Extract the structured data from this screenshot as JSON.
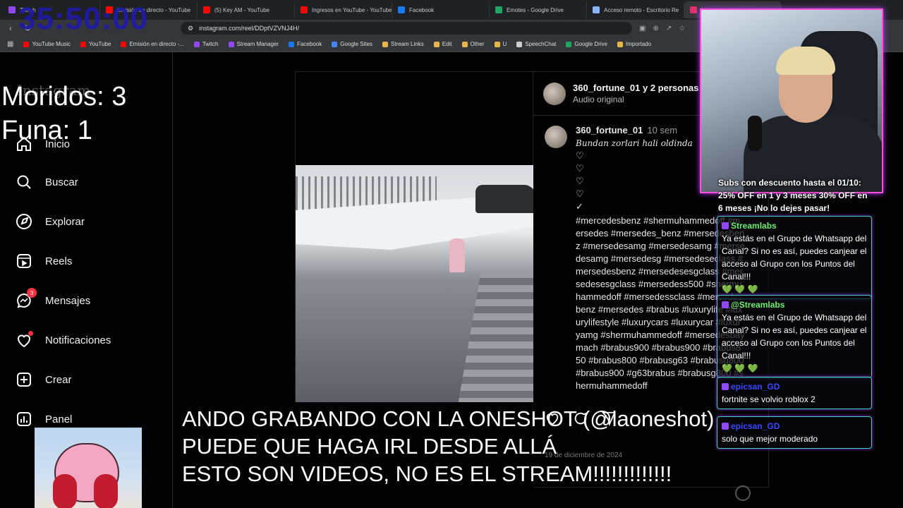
{
  "overlay": {
    "timer": "35:50:00",
    "deaths": "Moridos: 3",
    "funa": "Funa: 1",
    "promo": "Subs con descuento hasta el 01/10: 25% OFF en 1 y 3 meses 30% OFF en 6 meses ¡No lo dejes pasar!",
    "banner_lines": [
      "ANDO GRABANDO CON LA ONESHOT (@laoneshot)",
      "PUEDE QUE HAGA IRL DESDE ALLÁ",
      "ESTO SON VIDEOS, NO ES EL STREAM!!!!!!!!!!!!!"
    ],
    "chat": [
      {
        "user": "Streamlabs",
        "text": "Ya estás en el Grupo de Whatsapp del Canal? Si no es así, puedes canjear el acceso al Grupo con los Puntos del Canal!!!",
        "hearts": "💚 💚 💚"
      },
      {
        "user": "@Streamlabs",
        "text": "Ya estás en el Grupo de Whatsapp del Canal? Si no es así, puedes canjear el acceso al Grupo con los Puntos del Canal!!!",
        "hearts": "💚 💚 💚"
      },
      {
        "user": "epicsan_GD",
        "text": "fortnite se volvio roblox 2",
        "hearts": ""
      },
      {
        "user": "epicsan_GD",
        "text": "solo que mejor moderado",
        "hearts": ""
      }
    ]
  },
  "browser": {
    "tabs": [
      {
        "label": "Twitch",
        "color": "#9146ff"
      },
      {
        "label": "Emisión en directo - YouTube",
        "color": "#ff0000"
      },
      {
        "label": "(5) Key AM - YouTube",
        "color": "#ff0000"
      },
      {
        "label": "Ingresos en YouTube - YouTube",
        "color": "#ff0000"
      },
      {
        "label": "Facebook",
        "color": "#1877f2"
      },
      {
        "label": "Emotes - Google Drive",
        "color": "#1fa463"
      },
      {
        "label": "Acceso remoto - Escritorio Re",
        "color": "#8ab4f8"
      },
      {
        "label": "Instagram",
        "color": "#e1306c"
      }
    ],
    "url": "instagram.com/reel/DDptVZVNJ4H/",
    "bookmarks": [
      {
        "label": "YouTube Music",
        "color": "#ff0000"
      },
      {
        "label": "YouTube",
        "color": "#ff0000"
      },
      {
        "label": "Emisión en directo -...",
        "color": "#ff0000"
      },
      {
        "label": "Twitch",
        "color": "#9146ff"
      },
      {
        "label": "Stream Manager",
        "color": "#9146ff"
      },
      {
        "label": "Facebook",
        "color": "#1877f2"
      },
      {
        "label": "Google Sites",
        "color": "#4285f4"
      },
      {
        "label": "Stream Links",
        "color": "#e8b64a"
      },
      {
        "label": "Edit",
        "color": "#e8b64a"
      },
      {
        "label": "Other",
        "color": "#e8b64a"
      },
      {
        "label": "U",
        "color": "#e8b64a"
      },
      {
        "label": "SpeechChat",
        "color": "#cccccc"
      },
      {
        "label": "Google Drive",
        "color": "#1fa463"
      },
      {
        "label": "Importado",
        "color": "#e8b64a"
      }
    ]
  },
  "instagram": {
    "logo": "Instagram",
    "nav": [
      {
        "label": "Inicio",
        "icon": "home-icon"
      },
      {
        "label": "Buscar",
        "icon": "search-icon"
      },
      {
        "label": "Explorar",
        "icon": "compass-icon"
      },
      {
        "label": "Reels",
        "icon": "reels-icon"
      },
      {
        "label": "Mensajes",
        "icon": "messenger-icon",
        "badge": "3"
      },
      {
        "label": "Notificaciones",
        "icon": "heart-icon"
      },
      {
        "label": "Crear",
        "icon": "plus-square-icon"
      },
      {
        "label": "Panel",
        "icon": "chart-icon"
      }
    ],
    "post": {
      "header_user": "360_fortune_01 y 2 personas más",
      "header_sub": "Audio original",
      "caption_user": "360_fortune_01",
      "caption_time": "10 sem",
      "caption_first": "Bundan zorlari hali oldinda",
      "caption_lines": [
        "♡",
        "♡",
        "♡",
        "♡",
        "✓"
      ],
      "hashtags": "#mercedesbenz #shermuhammedoff #mersedes #mersedes_benz #mersedesbenz #mersedesamg #mersedesamg #mersedesamg #mersedesg #mersedeseclass #mersedesbenz #mersedesesgclass #mersedesesgclass #mersedess500 #shermuhammedoff #mersedessclass #mersedesbenz #mersedes #brabus #luxurylife #luxurylifestyle #luxurycars #luxurycar #luxuryamg #shermuhammedoff #mersedesbaymach #brabus900 #brabus900 #brabus850 #brabus800 #brabusg63 #brabusg800 #brabus900 #g63brabus #brabusg800 #shermuhammedoff",
      "date": "19 de diciembre de 2024"
    }
  }
}
